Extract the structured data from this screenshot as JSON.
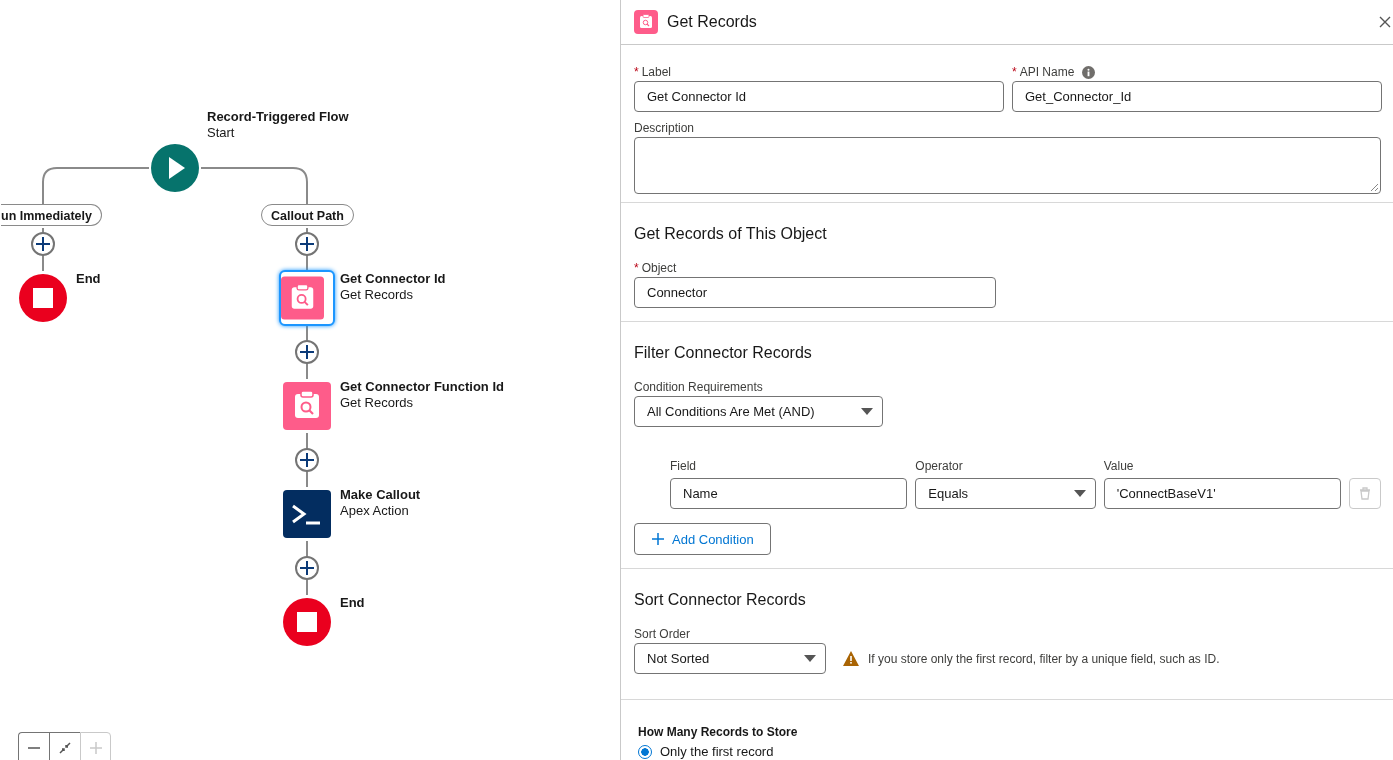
{
  "canvas": {
    "start": {
      "title": "Record-Triggered Flow",
      "subtitle": "Start"
    },
    "paths": [
      {
        "label": "un Immediately",
        "steps": [
          {
            "kind": "end",
            "title": "End"
          }
        ]
      },
      {
        "label": "Callout Path",
        "steps": [
          {
            "kind": "get_records",
            "title": "Get Connector Id",
            "subtitle": "Get Records",
            "selected": true
          },
          {
            "kind": "get_records",
            "title": "Get Connector Function Id",
            "subtitle": "Get Records",
            "selected": false
          },
          {
            "kind": "apex_action",
            "title": "Make Callout",
            "subtitle": "Apex Action",
            "selected": false
          },
          {
            "kind": "end",
            "title": "End"
          }
        ]
      }
    ],
    "zoom_controls": {
      "zoom_in_disabled": true
    }
  },
  "panel": {
    "title": "Get Records",
    "label_field": {
      "required_mark": "*",
      "label": "Label",
      "value": "Get Connector Id"
    },
    "api_name_field": {
      "required_mark": "*",
      "label": "API Name",
      "value": "Get_Connector_Id"
    },
    "description_field": {
      "label": "Description"
    },
    "object_section": {
      "heading": "Get Records of This Object",
      "object_field": {
        "required_mark": "*",
        "label": "Object",
        "value": "Connector"
      }
    },
    "filter_section": {
      "heading": "Filter Connector Records",
      "condition_requirements": {
        "label": "Condition Requirements",
        "value": "All Conditions Are Met (AND)"
      },
      "conditions": [
        {
          "field_label": "Field",
          "field": "Name",
          "operator_label": "Operator",
          "operator": "Equals",
          "value_label": "Value",
          "value": "'ConnectBaseV1'",
          "delete_disabled": true
        }
      ],
      "add_button": "Add Condition"
    },
    "sort_section": {
      "heading": "Sort Connector Records",
      "sort_order": {
        "label": "Sort Order",
        "value": "Not Sorted"
      },
      "warning": "If you store only the first record, filter by a unique field, such as ID."
    },
    "store_section": {
      "heading": "How Many Records to Store",
      "options": [
        {
          "label": "Only the first record",
          "selected": true
        }
      ]
    }
  }
}
